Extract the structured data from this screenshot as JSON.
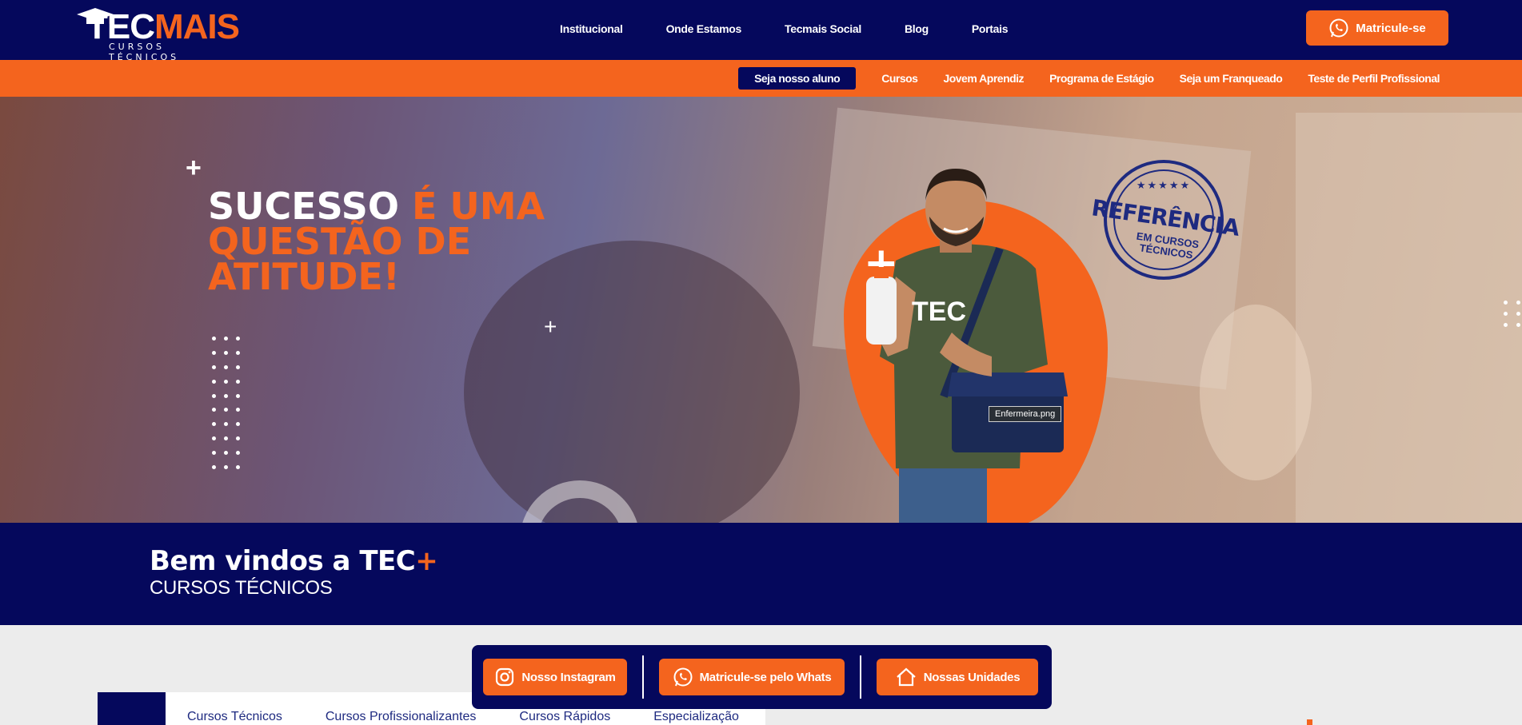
{
  "brand": {
    "tec": "TEC",
    "mais": "MAIS",
    "subtitle": "CURSOS TÉCNICOS"
  },
  "main_nav": [
    "Institucional",
    "Onde Estamos",
    "Tecmais Social",
    "Blog",
    "Portais"
  ],
  "header_cta": {
    "label": "Matricule-se",
    "icon": "whatsapp-icon"
  },
  "sub_nav": {
    "highlight": "Seja nosso aluno",
    "items": [
      "Cursos",
      "Jovem Aprendiz",
      "Programa de Estágio",
      "Seja um Franqueado",
      "Teste de Perfil Profissional"
    ]
  },
  "hero": {
    "headline_white": "SUCESSO",
    "headline_orange_1": "É UMA",
    "headline_orange_2": "QUESTÃO DE",
    "headline_orange_3": "ATITUDE!",
    "image_tooltip": "Enfermeira.png",
    "seal": {
      "main": "REFERÊNCIA",
      "line1": "EM CURSOS",
      "line2": "TÉCNICOS",
      "stars": "★★★★★"
    },
    "shirt_text": "TEC"
  },
  "welcome": {
    "title": "Bem vindos a TEC",
    "title_plus": "+",
    "subtitle": "CURSOS TÉCNICOS"
  },
  "actions": [
    {
      "label": "Nosso Instagram",
      "icon": "instagram-icon"
    },
    {
      "label": "Matricule-se pelo Whats",
      "icon": "whatsapp-icon"
    },
    {
      "label": "Nossas Unidades",
      "icon": "home-icon"
    }
  ],
  "course_tabs": [
    "Cursos Técnicos",
    "Cursos Profissionalizantes",
    "Cursos Rápidos",
    "Especialização"
  ],
  "colors": {
    "navy": "#05085c",
    "orange": "#f4641e",
    "white": "#ffffff"
  }
}
